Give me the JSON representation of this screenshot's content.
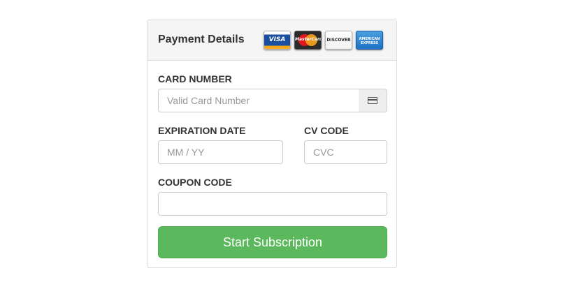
{
  "panel": {
    "title": "Payment Details",
    "card_logos": [
      {
        "name": "visa",
        "text": "VISA"
      },
      {
        "name": "mastercard",
        "text": "MasterCard"
      },
      {
        "name": "discover",
        "text": "DISCOVER"
      },
      {
        "name": "amex",
        "text": "AMERICAN EXPRESS"
      }
    ]
  },
  "form": {
    "card_number": {
      "label": "CARD NUMBER",
      "placeholder": "Valid Card Number",
      "value": "",
      "addon_icon": "credit-card-icon"
    },
    "expiration": {
      "label": "EXPIRATION DATE",
      "placeholder": "MM / YY",
      "value": ""
    },
    "cvc": {
      "label": "CV CODE",
      "placeholder": "CVC",
      "value": ""
    },
    "coupon": {
      "label": "COUPON CODE",
      "placeholder": "",
      "value": ""
    },
    "submit_label": "Start Subscription"
  },
  "colors": {
    "submit_bg": "#5cb85c",
    "heading_bg": "#f5f5f5",
    "border": "#dddddd"
  }
}
